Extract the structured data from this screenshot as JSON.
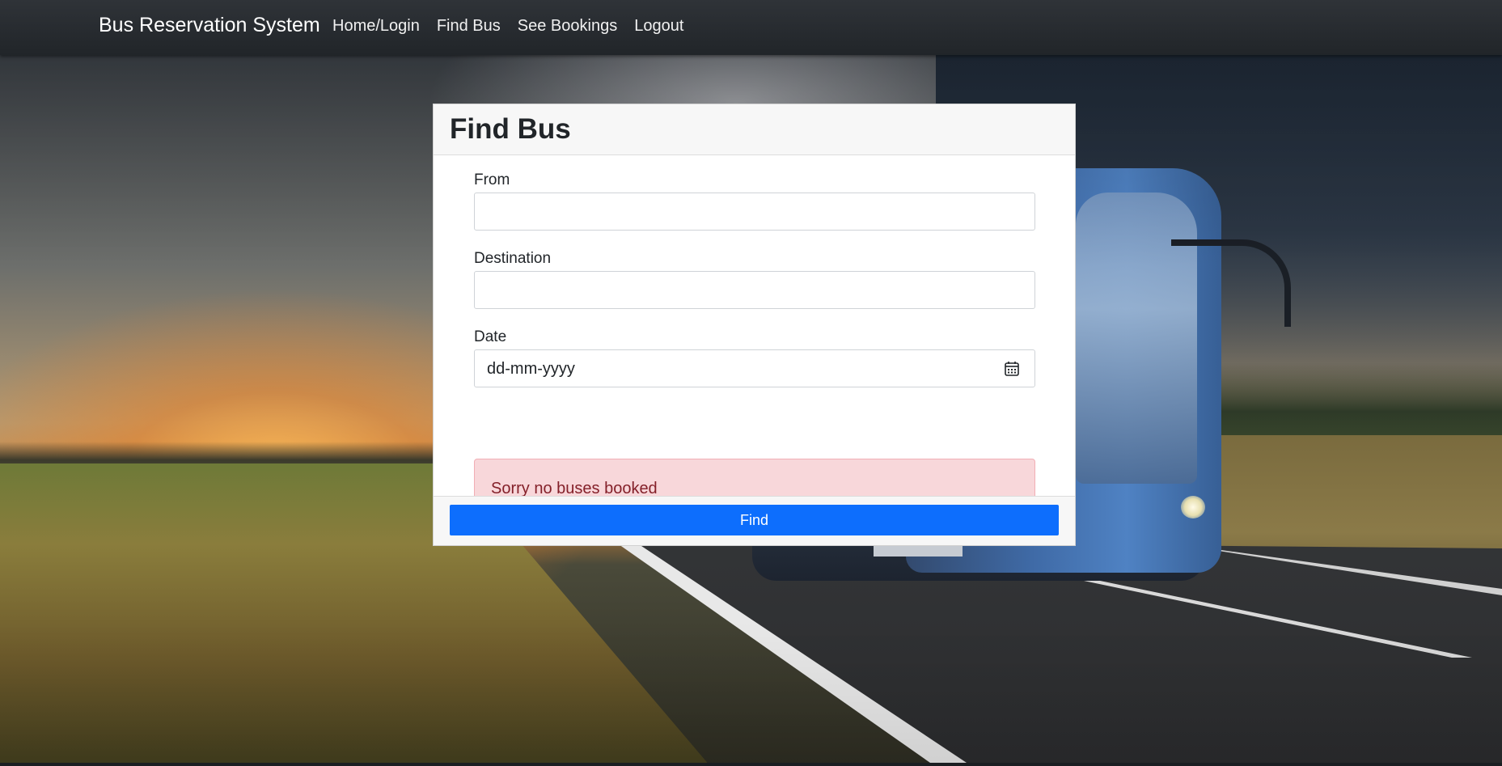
{
  "navbar": {
    "brand": "Bus Reservation System",
    "links": [
      {
        "label": "Home/Login"
      },
      {
        "label": "Find Bus"
      },
      {
        "label": "See Bookings"
      },
      {
        "label": "Logout"
      }
    ]
  },
  "form": {
    "title": "Find Bus",
    "fields": {
      "from": {
        "label": "From",
        "value": ""
      },
      "destination": {
        "label": "Destination",
        "value": ""
      },
      "date": {
        "label": "Date",
        "placeholder": "dd-mm-yyyy"
      }
    },
    "alert": "Sorry no buses booked",
    "submit_label": "Find"
  },
  "colors": {
    "navbar_bg": "#212529",
    "primary": "#0d6efd",
    "alert_bg": "#f8d7da",
    "alert_text": "#842029"
  },
  "icons": {
    "date_picker": "calendar-icon"
  }
}
